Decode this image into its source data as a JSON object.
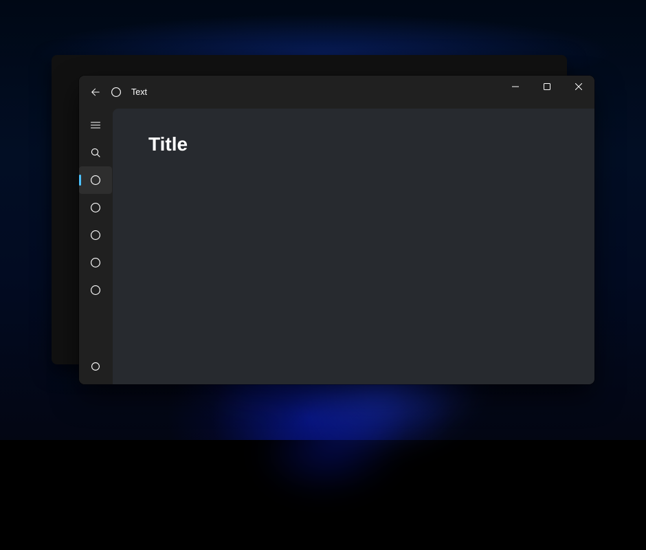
{
  "colors": {
    "accent": "#4cc2ff",
    "window_bg": "#202020",
    "content_bg": "#272a2f",
    "text": "#ffffff"
  },
  "desktop": {
    "description": "Windows 11 bloom wallpaper (dark blue)"
  },
  "back_window": {
    "present": true
  },
  "window": {
    "titlebar": {
      "back_button": true,
      "icon_name": "circle-icon",
      "title": "Text",
      "controls": {
        "minimize": true,
        "maximize": true,
        "close": true
      }
    },
    "sidebar": {
      "collapsed": true,
      "items": [
        {
          "icon": "hamburger-icon",
          "selected": false,
          "role": "menu-toggle"
        },
        {
          "icon": "search-icon",
          "selected": false,
          "role": "search"
        },
        {
          "icon": "circle-icon",
          "selected": true,
          "role": "nav"
        },
        {
          "icon": "circle-icon",
          "selected": false,
          "role": "nav"
        },
        {
          "icon": "circle-icon",
          "selected": false,
          "role": "nav"
        },
        {
          "icon": "circle-icon",
          "selected": false,
          "role": "nav"
        },
        {
          "icon": "circle-icon",
          "selected": false,
          "role": "nav"
        }
      ],
      "footer_item": {
        "icon": "circle-icon",
        "role": "settings"
      }
    },
    "content": {
      "title": "Title"
    }
  }
}
